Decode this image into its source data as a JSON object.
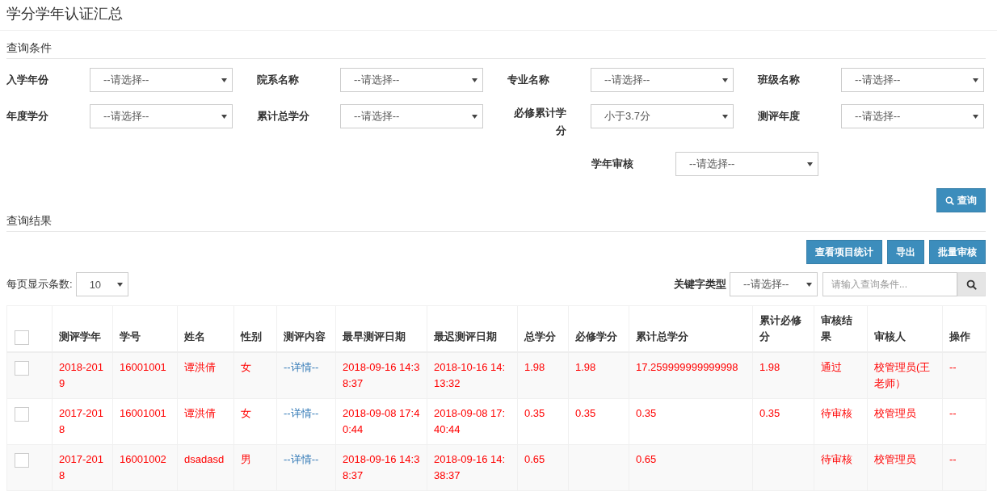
{
  "page_title": "学分学年认证汇总",
  "filter_section": {
    "title": "查询条件",
    "filters": [
      {
        "label": "入学年份",
        "value": "--请选择--"
      },
      {
        "label": "院系名称",
        "value": "--请选择--"
      },
      {
        "label": "专业名称",
        "value": "--请选择--"
      },
      {
        "label": "班级名称",
        "value": "--请选择--"
      },
      {
        "label": "年度学分",
        "value": "--请选择--"
      },
      {
        "label": "累计总学分",
        "value": "--请选择--"
      },
      {
        "label": "必修累计学分",
        "value": "小于3.7分"
      },
      {
        "label": "测评年度",
        "value": "--请选择--"
      },
      {
        "label": "学年审核",
        "value": "--请选择--"
      }
    ],
    "query_button": "查询"
  },
  "result_section": {
    "title": "查询结果",
    "actions": [
      "查看项目统计",
      "导出",
      "批量审核"
    ],
    "page_size_label": "每页显示条数:",
    "page_size": "10",
    "keyword_type_label": "关键字类型",
    "keyword_type": "--请选择--",
    "search_placeholder": "请输入查询条件..."
  },
  "table": {
    "header_checked": false,
    "columns": [
      {
        "label": "测评学年",
        "kind": "text"
      },
      {
        "label": "学号",
        "kind": "text"
      },
      {
        "label": "姓名",
        "kind": "text"
      },
      {
        "label": "性别",
        "kind": "text"
      },
      {
        "label": "测评内容",
        "kind": "link"
      },
      {
        "label": "最早测评日期",
        "kind": "text"
      },
      {
        "label": "最迟测评日期",
        "kind": "text"
      },
      {
        "label": "总学分",
        "kind": "text"
      },
      {
        "label": "必修学分",
        "kind": "text"
      },
      {
        "label": "累计总学分",
        "kind": "text"
      },
      {
        "label": "累计必修分",
        "kind": "text"
      },
      {
        "label": "审核结果",
        "kind": "text"
      },
      {
        "label": "审核人",
        "kind": "text"
      },
      {
        "label": "操作",
        "kind": "text"
      }
    ],
    "rows": [
      {
        "checked": false,
        "cells": [
          "2018-2019",
          "16001001",
          "谭洪倩",
          "女",
          "--详情--",
          "2018-09-16 14:38:37",
          "2018-10-16 14:13:32",
          "1.98",
          "1.98",
          "17.259999999999998",
          "1.98",
          "通过",
          "校管理员(王老师）",
          "--"
        ]
      },
      {
        "checked": false,
        "cells": [
          "2017-2018",
          "16001001",
          "谭洪倩",
          "女",
          "--详情--",
          "2018-09-08 17:40:44",
          "2018-09-08 17:40:44",
          "0.35",
          "0.35",
          "0.35",
          "0.35",
          "待审核",
          "校管理员",
          "--"
        ]
      },
      {
        "checked": false,
        "cells": [
          "2017-2018",
          "16001002",
          "dsadasd",
          "男",
          "--详情--",
          "2018-09-16 14:38:37",
          "2018-09-16 14:38:37",
          "0.65",
          "",
          "0.65",
          "",
          "待审核",
          "校管理员",
          "--"
        ]
      }
    ]
  }
}
